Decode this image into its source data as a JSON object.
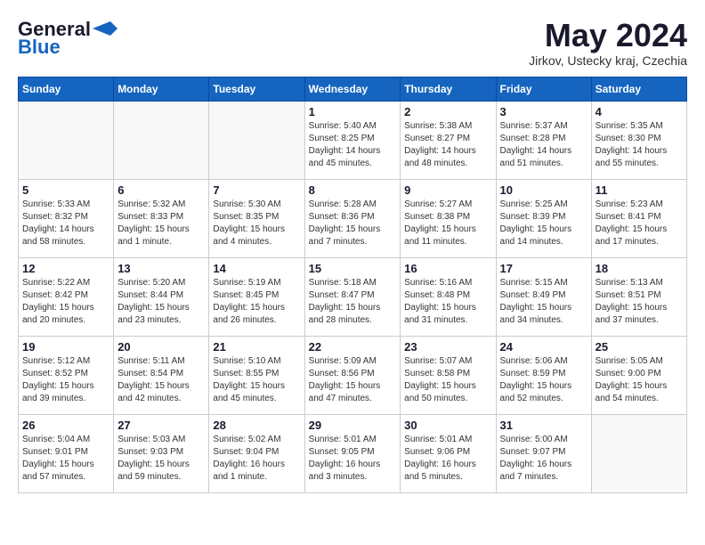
{
  "header": {
    "logo_general": "General",
    "logo_blue": "Blue",
    "month_title": "May 2024",
    "location": "Jirkov, Ustecky kraj, Czechia"
  },
  "days_of_week": [
    "Sunday",
    "Monday",
    "Tuesday",
    "Wednesday",
    "Thursday",
    "Friday",
    "Saturday"
  ],
  "weeks": [
    [
      {
        "day": "",
        "info": ""
      },
      {
        "day": "",
        "info": ""
      },
      {
        "day": "",
        "info": ""
      },
      {
        "day": "1",
        "info": "Sunrise: 5:40 AM\nSunset: 8:25 PM\nDaylight: 14 hours\nand 45 minutes."
      },
      {
        "day": "2",
        "info": "Sunrise: 5:38 AM\nSunset: 8:27 PM\nDaylight: 14 hours\nand 48 minutes."
      },
      {
        "day": "3",
        "info": "Sunrise: 5:37 AM\nSunset: 8:28 PM\nDaylight: 14 hours\nand 51 minutes."
      },
      {
        "day": "4",
        "info": "Sunrise: 5:35 AM\nSunset: 8:30 PM\nDaylight: 14 hours\nand 55 minutes."
      }
    ],
    [
      {
        "day": "5",
        "info": "Sunrise: 5:33 AM\nSunset: 8:32 PM\nDaylight: 14 hours\nand 58 minutes."
      },
      {
        "day": "6",
        "info": "Sunrise: 5:32 AM\nSunset: 8:33 PM\nDaylight: 15 hours\nand 1 minute."
      },
      {
        "day": "7",
        "info": "Sunrise: 5:30 AM\nSunset: 8:35 PM\nDaylight: 15 hours\nand 4 minutes."
      },
      {
        "day": "8",
        "info": "Sunrise: 5:28 AM\nSunset: 8:36 PM\nDaylight: 15 hours\nand 7 minutes."
      },
      {
        "day": "9",
        "info": "Sunrise: 5:27 AM\nSunset: 8:38 PM\nDaylight: 15 hours\nand 11 minutes."
      },
      {
        "day": "10",
        "info": "Sunrise: 5:25 AM\nSunset: 8:39 PM\nDaylight: 15 hours\nand 14 minutes."
      },
      {
        "day": "11",
        "info": "Sunrise: 5:23 AM\nSunset: 8:41 PM\nDaylight: 15 hours\nand 17 minutes."
      }
    ],
    [
      {
        "day": "12",
        "info": "Sunrise: 5:22 AM\nSunset: 8:42 PM\nDaylight: 15 hours\nand 20 minutes."
      },
      {
        "day": "13",
        "info": "Sunrise: 5:20 AM\nSunset: 8:44 PM\nDaylight: 15 hours\nand 23 minutes."
      },
      {
        "day": "14",
        "info": "Sunrise: 5:19 AM\nSunset: 8:45 PM\nDaylight: 15 hours\nand 26 minutes."
      },
      {
        "day": "15",
        "info": "Sunrise: 5:18 AM\nSunset: 8:47 PM\nDaylight: 15 hours\nand 28 minutes."
      },
      {
        "day": "16",
        "info": "Sunrise: 5:16 AM\nSunset: 8:48 PM\nDaylight: 15 hours\nand 31 minutes."
      },
      {
        "day": "17",
        "info": "Sunrise: 5:15 AM\nSunset: 8:49 PM\nDaylight: 15 hours\nand 34 minutes."
      },
      {
        "day": "18",
        "info": "Sunrise: 5:13 AM\nSunset: 8:51 PM\nDaylight: 15 hours\nand 37 minutes."
      }
    ],
    [
      {
        "day": "19",
        "info": "Sunrise: 5:12 AM\nSunset: 8:52 PM\nDaylight: 15 hours\nand 39 minutes."
      },
      {
        "day": "20",
        "info": "Sunrise: 5:11 AM\nSunset: 8:54 PM\nDaylight: 15 hours\nand 42 minutes."
      },
      {
        "day": "21",
        "info": "Sunrise: 5:10 AM\nSunset: 8:55 PM\nDaylight: 15 hours\nand 45 minutes."
      },
      {
        "day": "22",
        "info": "Sunrise: 5:09 AM\nSunset: 8:56 PM\nDaylight: 15 hours\nand 47 minutes."
      },
      {
        "day": "23",
        "info": "Sunrise: 5:07 AM\nSunset: 8:58 PM\nDaylight: 15 hours\nand 50 minutes."
      },
      {
        "day": "24",
        "info": "Sunrise: 5:06 AM\nSunset: 8:59 PM\nDaylight: 15 hours\nand 52 minutes."
      },
      {
        "day": "25",
        "info": "Sunrise: 5:05 AM\nSunset: 9:00 PM\nDaylight: 15 hours\nand 54 minutes."
      }
    ],
    [
      {
        "day": "26",
        "info": "Sunrise: 5:04 AM\nSunset: 9:01 PM\nDaylight: 15 hours\nand 57 minutes."
      },
      {
        "day": "27",
        "info": "Sunrise: 5:03 AM\nSunset: 9:03 PM\nDaylight: 15 hours\nand 59 minutes."
      },
      {
        "day": "28",
        "info": "Sunrise: 5:02 AM\nSunset: 9:04 PM\nDaylight: 16 hours\nand 1 minute."
      },
      {
        "day": "29",
        "info": "Sunrise: 5:01 AM\nSunset: 9:05 PM\nDaylight: 16 hours\nand 3 minutes."
      },
      {
        "day": "30",
        "info": "Sunrise: 5:01 AM\nSunset: 9:06 PM\nDaylight: 16 hours\nand 5 minutes."
      },
      {
        "day": "31",
        "info": "Sunrise: 5:00 AM\nSunset: 9:07 PM\nDaylight: 16 hours\nand 7 minutes."
      },
      {
        "day": "",
        "info": ""
      }
    ]
  ]
}
